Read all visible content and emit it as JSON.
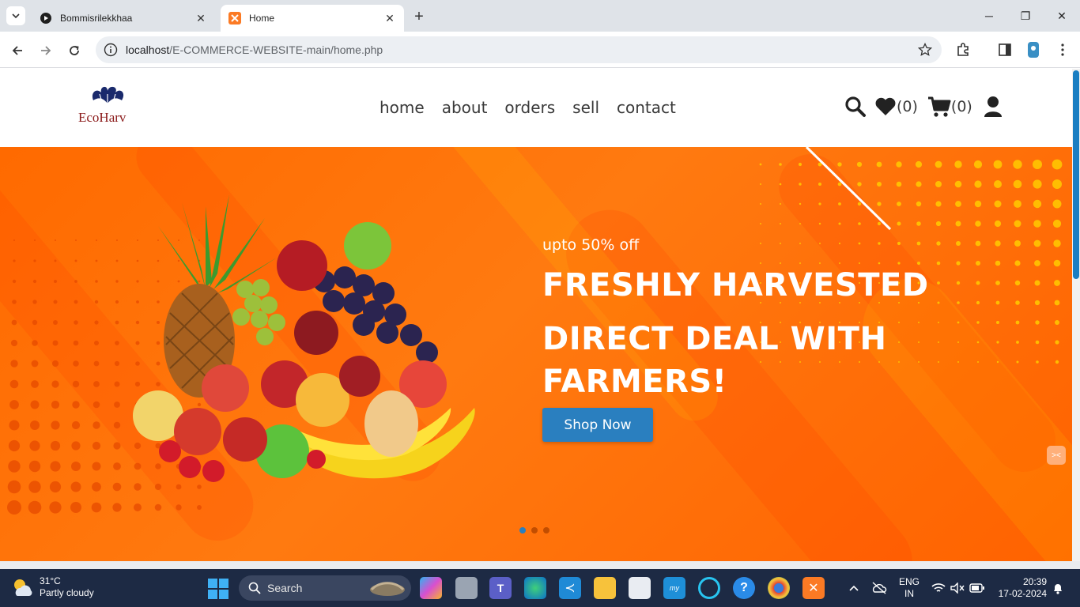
{
  "browser": {
    "tabs": [
      {
        "title": "Bommisrilekkhaa",
        "active": false
      },
      {
        "title": "Home",
        "active": true
      }
    ],
    "address": {
      "host": "localhost",
      "path": "/E-COMMERCE-WEBSITE-main/home.php"
    }
  },
  "site": {
    "logo_text": "EcoHarv",
    "nav": [
      "home",
      "about",
      "orders",
      "sell",
      "contact"
    ],
    "wishlist_count": "(0)",
    "cart_count": "(0)",
    "hero": {
      "tagline": "upto 50% off",
      "heading1": "FRESHLY HARVESTED",
      "heading2": "DIRECT DEAL WITH FARMERS!",
      "button": "Shop Now",
      "slides": 3,
      "active_slide": 1
    },
    "colors": {
      "hero_bg": "#ff6a00",
      "button": "#2a7fbf"
    }
  },
  "taskbar": {
    "weather_temp": "31°C",
    "weather_desc": "Partly cloudy",
    "search_label": "Search",
    "lang_line1": "ENG",
    "lang_line2": "IN",
    "time": "20:39",
    "date": "17-02-2024"
  }
}
